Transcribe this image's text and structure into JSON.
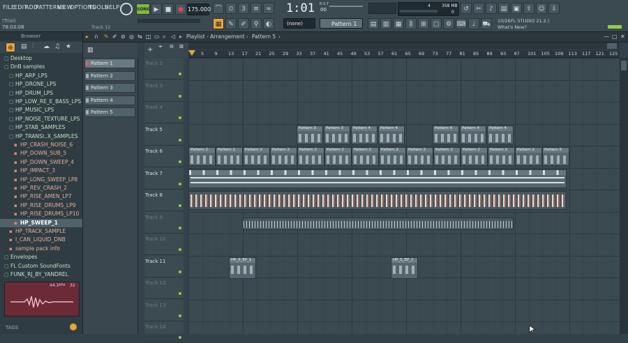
{
  "menu": [
    "FILE",
    "EDIT",
    "ADD",
    "PATTERNS",
    "VIEW",
    "OPTIONS",
    "TOOLS",
    "HELP"
  ],
  "transport": {
    "mode": "SONG",
    "tempo": "175.000",
    "time": "1:01",
    "time_sub": "00",
    "bst": "B:S:T",
    "play_label": "▶",
    "stop_label": "■",
    "rec_label": "●"
  },
  "info": {
    "trial": "(Trial)",
    "clock": "78:03:08",
    "track": "Track 12"
  },
  "cpu": {
    "cores": "4",
    "ram": "358 MB",
    "voices": "0"
  },
  "pattern_selector": {
    "none_label": "(none)",
    "pattern": "Pattern 1"
  },
  "news": {
    "date": "10/26",
    "title": "FL STUDIO 21.2 |",
    "link": "What's New?"
  },
  "browser": {
    "title": "Browser",
    "items": [
      {
        "label": "Desktop",
        "kind": "folder",
        "indent": 1
      },
      {
        "label": "DnB samples",
        "kind": "folder",
        "indent": 1
      },
      {
        "label": "HP_ARP_LPS",
        "kind": "folder",
        "indent": 2
      },
      {
        "label": "HP_DRONE_LPS",
        "kind": "folder",
        "indent": 2
      },
      {
        "label": "HP_DRUM_LPS",
        "kind": "folder",
        "indent": 2
      },
      {
        "label": "HP_LOW_RE_E_BASS_LPS",
        "kind": "folder",
        "indent": 2
      },
      {
        "label": "HP_MUSIC_LPS",
        "kind": "folder",
        "indent": 2
      },
      {
        "label": "HP_NOISE_TEXTURE_LPS",
        "kind": "folder",
        "indent": 2
      },
      {
        "label": "HP_STAB_SAMPLES",
        "kind": "folder",
        "indent": 2
      },
      {
        "label": "HP_TRANSI..X_SAMPLES",
        "kind": "folder",
        "indent": 2
      },
      {
        "label": "HP_CRASH_NOISE_6",
        "kind": "file",
        "indent": 3
      },
      {
        "label": "HP_DOWN_SUB_5",
        "kind": "file",
        "indent": 3
      },
      {
        "label": "HP_DOWN_SWEEP_4",
        "kind": "file",
        "indent": 3
      },
      {
        "label": "HP_IMPACT_3",
        "kind": "file",
        "indent": 3
      },
      {
        "label": "HP_LONG_SWEEP_LP8",
        "kind": "file",
        "indent": 3
      },
      {
        "label": "HP_REV_CRASH_2",
        "kind": "file",
        "indent": 3
      },
      {
        "label": "HP_RISE_AMEN_LP7",
        "kind": "file",
        "indent": 3
      },
      {
        "label": "HP_RISE_DRUMS_LP9",
        "kind": "file",
        "indent": 3
      },
      {
        "label": "HP_RISE_DRUMS_LP10",
        "kind": "file",
        "indent": 3
      },
      {
        "label": "HP_SWEEP_1",
        "kind": "selected",
        "indent": 3
      },
      {
        "label": "HP_TRACK_SAMPLE",
        "kind": "file",
        "indent": 2
      },
      {
        "label": "I_CAN_LIQUID_DNB",
        "kind": "file",
        "indent": 2
      },
      {
        "label": "sample pack info",
        "kind": "file",
        "indent": 2
      },
      {
        "label": "Envelopes",
        "kind": "folder",
        "indent": 1
      },
      {
        "label": "FL Custom SoundFonts",
        "kind": "folder",
        "indent": 1
      },
      {
        "label": "FUNK_RJ_BY_YANDREL",
        "kind": "folder",
        "indent": 1
      }
    ],
    "preview": {
      "rate": "44.1",
      "unit": "kHz",
      "bits": "32"
    },
    "tags_label": "TAGS"
  },
  "playlist": {
    "title": "Playlist - Arrangement",
    "current": "Pattern 5"
  },
  "patterns": [
    "Pattern 1",
    "Pattern 2",
    "Pattern 3",
    "Pattern 4",
    "Pattern 5"
  ],
  "ruler": [
    "5",
    "9",
    "13",
    "17",
    "21",
    "25",
    "29",
    "33",
    "37",
    "41",
    "45",
    "49",
    "53",
    "57",
    "61",
    "65",
    "69",
    "73",
    "77",
    "81",
    "85",
    "89",
    "93",
    "97",
    "101",
    "105",
    "109",
    "113",
    "117",
    "121",
    "125"
  ],
  "tracks": [
    "Track 2",
    "Track 3",
    "Track 4",
    "Track 5",
    "Track 6",
    "Track 7",
    "Track 8",
    "Track 9",
    "Track 10",
    "Track 11",
    "Track 12",
    "Track 13",
    "Track 14"
  ],
  "clips": {
    "track5": [
      "Pattern 3",
      "Pattern 3",
      "Pattern 4",
      "Pattern 4",
      "Pattern 4",
      "Pattern 4",
      "Pattern 4"
    ],
    "track6": [
      "Pattern 2",
      "Pattern 2",
      "Pattern 2",
      "Pattern 2",
      "Pattern 2",
      "Pattern 2",
      "Pattern 2",
      "Pattern 2",
      "Pattern 2",
      "Pattern 2",
      "Pattern 2",
      "Pattern 2",
      "Pattern 2",
      "Pattern 5"
    ],
    "track11": [
      "HP_S_EP_1",
      "HP_S_EP_1"
    ]
  },
  "colors": {
    "accent": "#e8a33a",
    "grid": "#3b4950",
    "clip": "#56666e",
    "dot": "#8ed04a",
    "selected": "#cfe0f0"
  }
}
